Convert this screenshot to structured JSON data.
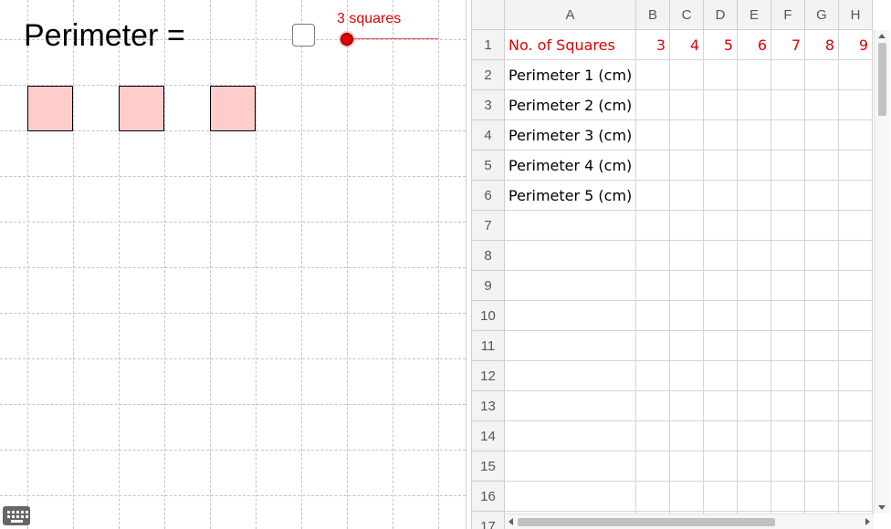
{
  "graphics": {
    "perimeter_label": "Perimeter =",
    "checkbox_checked": false,
    "slider": {
      "caption": "3 squares",
      "value": 3,
      "color": "#e10000"
    },
    "square_count": 3,
    "square_fill": "#ffcccc"
  },
  "spreadsheet": {
    "columns": [
      "A",
      "B",
      "C",
      "D",
      "E",
      "F",
      "G",
      "H"
    ],
    "rows": [
      "1",
      "2",
      "3",
      "4",
      "5",
      "6",
      "7",
      "8",
      "9",
      "10",
      "11",
      "12",
      "13",
      "14",
      "15",
      "16",
      "17"
    ],
    "cells": [
      [
        "No. of Squares",
        "3",
        "4",
        "5",
        "6",
        "7",
        "8",
        "9"
      ],
      [
        "Perimeter 1 (cm)",
        "",
        "",
        "",
        "",
        "",
        "",
        ""
      ],
      [
        "Perimeter 2 (cm)",
        "",
        "",
        "",
        "",
        "",
        "",
        ""
      ],
      [
        "Perimeter 3 (cm)",
        "",
        "",
        "",
        "",
        "",
        "",
        ""
      ],
      [
        "Perimeter 4 (cm)",
        "",
        "",
        "",
        "",
        "",
        "",
        ""
      ],
      [
        "Perimeter 5 (cm)",
        "",
        "",
        "",
        "",
        "",
        "",
        ""
      ]
    ],
    "red_rows": [
      1
    ],
    "text_color_red": "#e10000"
  },
  "icons": {
    "keyboard": "keyboard-icon"
  }
}
